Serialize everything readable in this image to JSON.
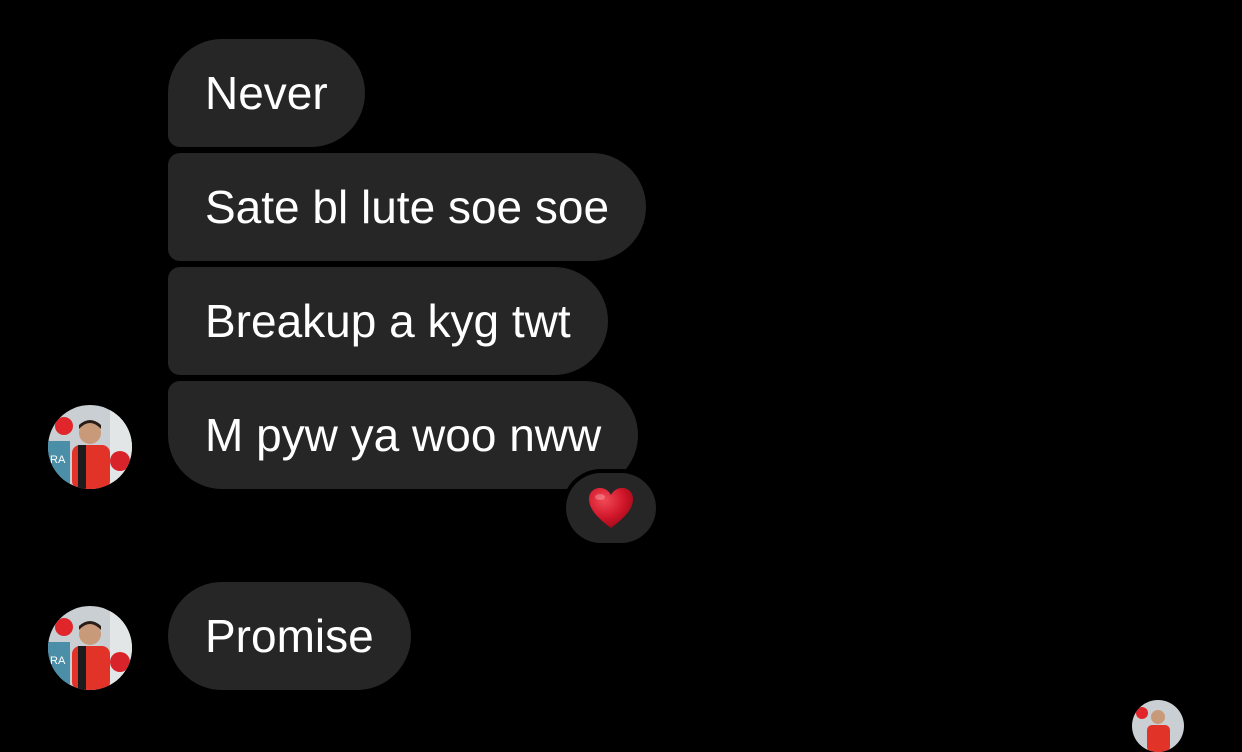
{
  "chat": {
    "messages": [
      {
        "text": "Never"
      },
      {
        "text": "Sate bl lute soe soe"
      },
      {
        "text": "Breakup a kyg twt"
      },
      {
        "text": "M pyw ya woo nww"
      },
      {
        "text": "Promise"
      }
    ],
    "reaction": {
      "emoji": "❤️",
      "icon": "red-heart-icon",
      "color": "#c8102e"
    }
  },
  "colors": {
    "background": "#000000",
    "bubble": "#262626",
    "text": "#ffffff"
  }
}
